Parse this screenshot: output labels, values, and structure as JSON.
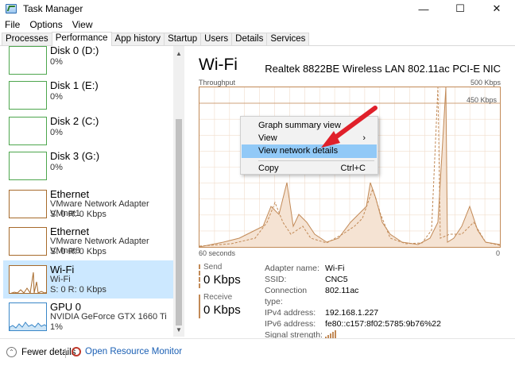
{
  "window": {
    "title": "Task Manager",
    "minimize": "—",
    "maximize": "☐",
    "close": "✕"
  },
  "menu": [
    "File",
    "Options",
    "View"
  ],
  "tabs": [
    "Processes",
    "Performance",
    "App history",
    "Startup",
    "Users",
    "Details",
    "Services"
  ],
  "sidebar": {
    "items": [
      {
        "title": "Disk 0 (D:)",
        "sub1": "0%",
        "sub2": ""
      },
      {
        "title": "Disk 1 (E:)",
        "sub1": "0%",
        "sub2": ""
      },
      {
        "title": "Disk 2 (C:)",
        "sub1": "0%",
        "sub2": ""
      },
      {
        "title": "Disk 3 (G:)",
        "sub1": "0%",
        "sub2": ""
      },
      {
        "title": "Ethernet",
        "sub1": "VMware Network Adapter VMnet1",
        "sub2": "S: 0 R: 0 Kbps"
      },
      {
        "title": "Ethernet",
        "sub1": "VMware Network Adapter VMnet8",
        "sub2": "S: 0 R: 0 Kbps"
      },
      {
        "title": "Wi-Fi",
        "sub1": "Wi-Fi",
        "sub2": "S: 0 R: 0 Kbps"
      },
      {
        "title": "GPU 0",
        "sub1": "NVIDIA GeForce GTX 1660 Ti",
        "sub2": "1%"
      }
    ]
  },
  "panel": {
    "title": "Wi-Fi",
    "device": "Realtek 8822BE Wireless LAN 802.11ac PCI-E NIC",
    "graph_label": "Throughput",
    "max_label": "500 Kbps",
    "ref_label": "450 Kbps",
    "time_left": "60 seconds",
    "time_right": "0"
  },
  "stats": {
    "send_label": "Send",
    "send_value": "0 Kbps",
    "receive_label": "Receive",
    "receive_value": "0 Kbps"
  },
  "details": [
    {
      "key": "Adapter name:",
      "value": "Wi-Fi"
    },
    {
      "key": "SSID:",
      "value": "CNC5"
    },
    {
      "key": "Connection type:",
      "value": "802.11ac"
    },
    {
      "key": "IPv4 address:",
      "value": "192.168.1.227"
    },
    {
      "key": "IPv6 address:",
      "value": "fe80::c157:8f02:5785:9b76%22"
    },
    {
      "key": "Signal strength:",
      "value": ""
    }
  ],
  "context_menu": {
    "items": [
      {
        "label": "Graph summary view",
        "shortcut": ""
      },
      {
        "label": "View",
        "shortcut": "›"
      },
      {
        "label": "View network details",
        "shortcut": ""
      },
      {
        "label": "Copy",
        "shortcut": "Ctrl+C"
      }
    ]
  },
  "footer": {
    "fewer": "Fewer details",
    "open_rm": "Open Resource Monitor"
  },
  "colors": {
    "accent": "#c28a57",
    "selected": "#cce8ff",
    "arrow": "#e0202a",
    "highlight": "#91c9f7"
  }
}
